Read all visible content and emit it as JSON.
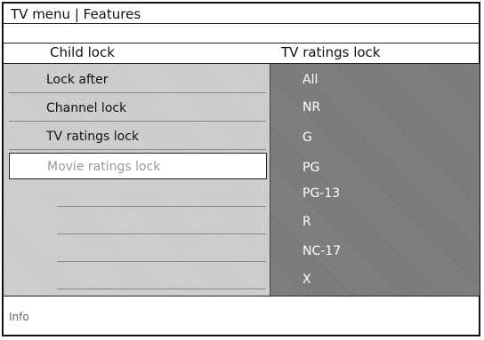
{
  "header": {
    "title": "TV menu | Features"
  },
  "columns": {
    "left_title": "Child lock",
    "right_title": "TV ratings lock"
  },
  "menu": {
    "items": [
      {
        "label": "Lock after"
      },
      {
        "label": "Channel lock"
      },
      {
        "label": "TV ratings lock"
      },
      {
        "label": "Movie ratings lock"
      }
    ]
  },
  "ratings": {
    "options": [
      "All",
      "NR",
      "G",
      "PG",
      "PG-13",
      "R",
      "NC-17",
      "X"
    ]
  },
  "footer": {
    "info": "Info"
  }
}
